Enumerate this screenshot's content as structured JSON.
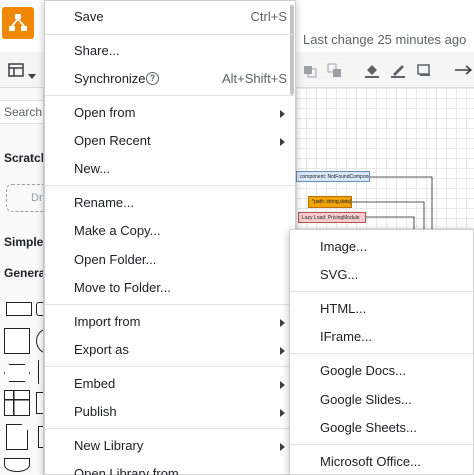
{
  "app": {
    "last_change": "Last change 25 minutes ago"
  },
  "sidebar": {
    "search_placeholder": "Search S",
    "scratchpad_label": "Scratch",
    "draft_label": "Dr",
    "simple_label": "Simple",
    "general_label": "Genera"
  },
  "canvas": {
    "nodes": [
      "component: NotFoundComponent",
      "*path: string,data)",
      "Lazy Load: PricingModule"
    ]
  },
  "file_menu": {
    "items": [
      {
        "label": "Save",
        "shortcut": "Ctrl+S"
      },
      {
        "label": "Share..."
      },
      {
        "label": "Synchronize",
        "shortcut": "Alt+Shift+S"
      },
      {
        "label": "Open from"
      },
      {
        "label": "Open Recent"
      },
      {
        "label": "New..."
      },
      {
        "label": "Rename..."
      },
      {
        "label": "Make a Copy..."
      },
      {
        "label": "Open Folder..."
      },
      {
        "label": "Move to Folder..."
      },
      {
        "label": "Import from"
      },
      {
        "label": "Export as"
      },
      {
        "label": "Embed"
      },
      {
        "label": "Publish"
      },
      {
        "label": "New Library"
      },
      {
        "label": "Open Library from"
      }
    ]
  },
  "export_submenu": {
    "items": [
      {
        "label": "Image..."
      },
      {
        "label": "SVG..."
      },
      {
        "label": "HTML..."
      },
      {
        "label": "IFrame..."
      },
      {
        "label": "Google Docs..."
      },
      {
        "label": "Google Slides..."
      },
      {
        "label": "Google Sheets..."
      },
      {
        "label": "Microsoft Office..."
      }
    ]
  },
  "colors": {
    "brand": "#f08705",
    "node_blue": "#dae8fc",
    "node_orange": "#f0a30a",
    "node_red": "#f8cecc"
  }
}
